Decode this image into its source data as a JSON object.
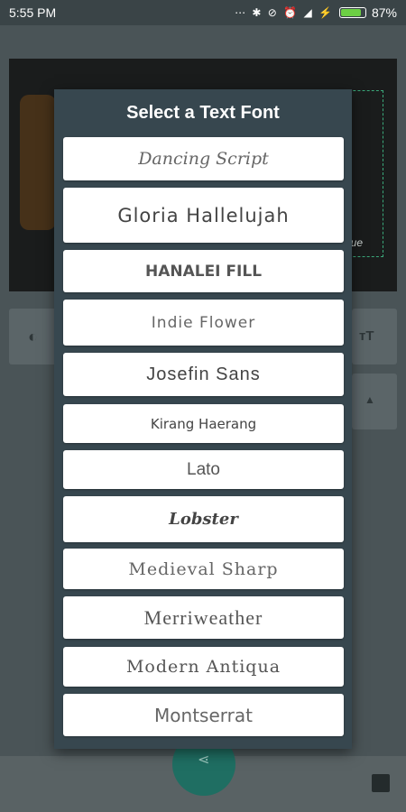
{
  "status_bar": {
    "time": "5:55 PM",
    "icons": "⋯ ✱ ⊘ ⏰ ◢ ⚡",
    "battery_percent": "87%",
    "battery_level": 0.87
  },
  "background": {
    "canvas_caption": "gue"
  },
  "dialog": {
    "title": "Select a Text Font",
    "fonts": [
      {
        "label": "Dancing Script"
      },
      {
        "label": "Gloria Hallelujah"
      },
      {
        "label": "HANALEI FILL"
      },
      {
        "label": "Indie Flower"
      },
      {
        "label": "Josefin Sans"
      },
      {
        "label": "Kirang Haerang"
      },
      {
        "label": "Lato"
      },
      {
        "label": "Lobster"
      },
      {
        "label": "Medieval Sharp"
      },
      {
        "label": "Merriweather"
      },
      {
        "label": "Modern Antiqua"
      },
      {
        "label": "Montserrat"
      }
    ]
  },
  "icons": {
    "opacity": "opacity-icon",
    "text_size": "text-size-icon",
    "chevron_up": "chevron-up-icon",
    "share": "share-icon",
    "save": "save-icon"
  },
  "colors": {
    "dialog_bg": "#37474f",
    "fab": "#1f6e62",
    "battery": "#6ccf44"
  }
}
